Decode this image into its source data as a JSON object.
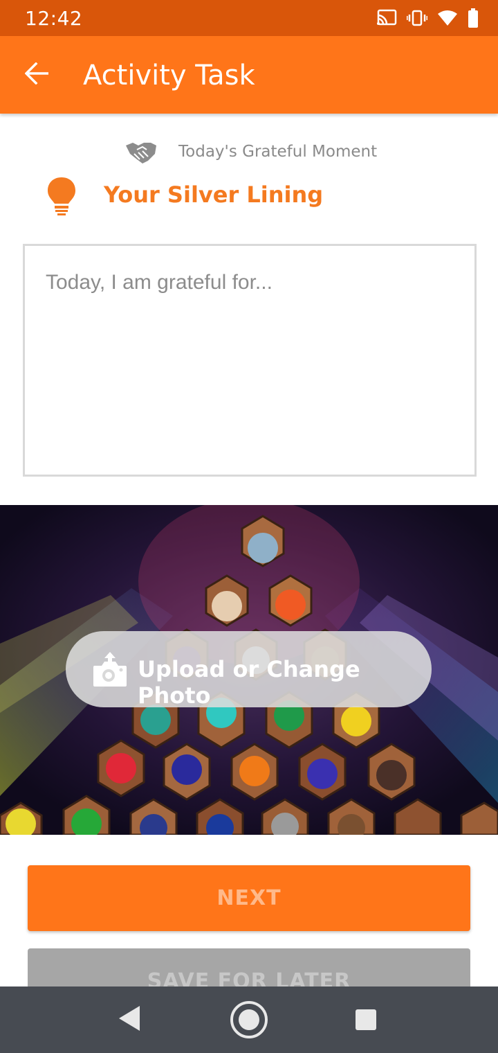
{
  "status_bar": {
    "time": "12:42",
    "icons": [
      "cast-icon",
      "vibrate-icon",
      "wifi-icon",
      "battery-icon"
    ]
  },
  "app_bar": {
    "back_icon": "arrow-left-icon",
    "title": "Activity Task"
  },
  "moment": {
    "icon": "handshake-icon",
    "label": "Today's Grateful Moment"
  },
  "silver_lining": {
    "icon": "lightbulb-icon",
    "title": "Your Silver Lining"
  },
  "entry": {
    "placeholder": "Today, I am grateful for...",
    "value": ""
  },
  "photo": {
    "upload_icon": "camera-upload-icon",
    "upload_label": "Upload or Change Photo"
  },
  "actions": {
    "next_label": "NEXT",
    "save_label": "SAVE FOR LATER"
  },
  "nav_bar": {
    "icons": [
      "nav-back-icon",
      "nav-home-icon",
      "nav-recent-icon"
    ]
  },
  "colors": {
    "status_bar": "#d9560a",
    "accent": "#ff7519",
    "title_orange": "#f47a20",
    "nav_bar": "#474b52"
  }
}
